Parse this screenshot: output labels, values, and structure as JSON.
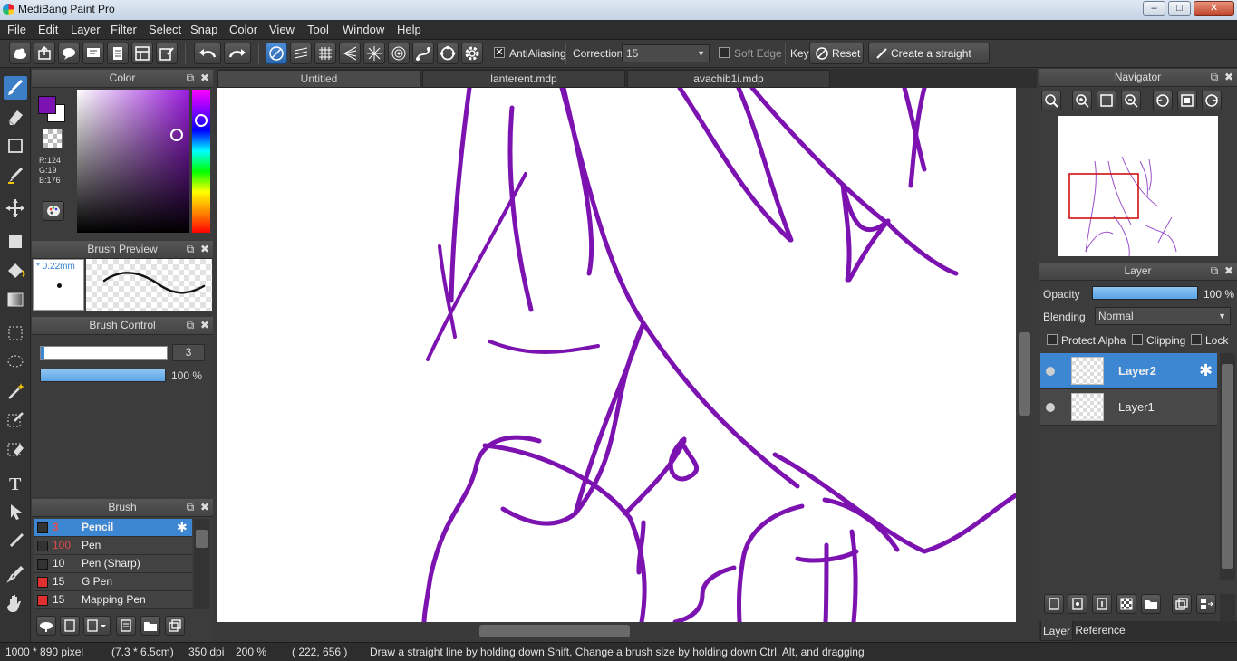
{
  "app": {
    "title": "MediBang Paint Pro"
  },
  "menu": [
    "File",
    "Edit",
    "Layer",
    "Filter",
    "Select",
    "Snap",
    "Color",
    "View",
    "Tool",
    "Window",
    "Help"
  ],
  "toolbar": {
    "antialiasing_label": "AntiAliasing",
    "correction_label": "Correction",
    "correction_value": "15",
    "soft_edge_label": "Soft Edge",
    "key_label": "Key",
    "reset_label": "Reset",
    "straight_line_label": "Create a straight line"
  },
  "color_panel": {
    "title": "Color",
    "r": "R:124",
    "g": "G:19",
    "b": "B:176",
    "main_color": "#7c13b0"
  },
  "brush_preview": {
    "title": "Brush Preview",
    "size_label": "* 0.22mm"
  },
  "brush_control": {
    "title": "Brush Control",
    "size_value": "3",
    "opacity_value": "100 %"
  },
  "brush_panel": {
    "title": "Brush",
    "items": [
      {
        "size": "3",
        "name": "Pencil",
        "color": "#333333"
      },
      {
        "size": "100",
        "name": "Pen",
        "color": "#333333"
      },
      {
        "size": "10",
        "name": "Pen (Sharp)",
        "color": "#333333"
      },
      {
        "size": "15",
        "name": "G Pen",
        "color": "#e03030"
      },
      {
        "size": "15",
        "name": "Mapping Pen",
        "color": "#e03030"
      }
    ]
  },
  "tabs": [
    "Untitled",
    "lanterent.mdp",
    "avachib1i.mdp"
  ],
  "navigator": {
    "title": "Navigator"
  },
  "layer_panel": {
    "title": "Layer",
    "opacity_label": "Opacity",
    "opacity_value": "100 %",
    "opacity_fraction": 1.0,
    "blending_label": "Blending",
    "blending_value": "Normal",
    "protect_alpha_label": "Protect Alpha",
    "clipping_label": "Clipping",
    "lock_label": "Lock",
    "layers": [
      "Layer2",
      "Layer1"
    ]
  },
  "bottom_tabs": [
    "Layer",
    "Reference"
  ],
  "status": {
    "canvas_size": "1000 * 890 pixel",
    "physical_size": "(7.3 * 6.5cm)",
    "dpi": "350 dpi",
    "zoom": "200 %",
    "cursor": "( 222, 656 )",
    "hint": "Draw a straight line by holding down Shift, Change a brush size by holding down Ctrl, Alt, and dragging"
  },
  "colors": {
    "accent": "#3d86d2",
    "stroke": "#7c13b0"
  }
}
